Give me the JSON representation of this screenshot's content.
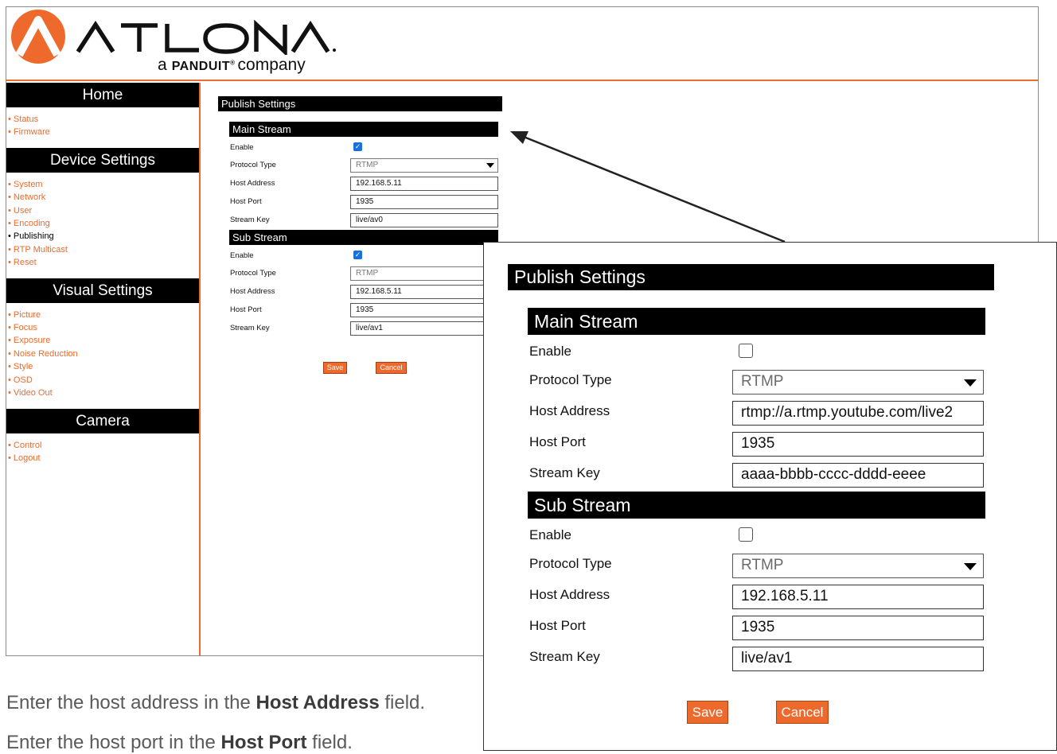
{
  "brand": {
    "wordmark": "ATLONA",
    "tagline_prefix": "a",
    "tagline_brand": "PANDUIT",
    "tagline_tm": "®",
    "tagline_suffix": "company",
    "accent_color": "#ee6a2c"
  },
  "sidebar": {
    "sections": [
      {
        "title": "Home",
        "items": [
          {
            "label": "Status"
          },
          {
            "label": "Firmware"
          }
        ]
      },
      {
        "title": "Device Settings",
        "items": [
          {
            "label": "System"
          },
          {
            "label": "Network"
          },
          {
            "label": "User"
          },
          {
            "label": "Encoding"
          },
          {
            "label": "Publishing",
            "active": true
          },
          {
            "label": "RTP Multicast"
          },
          {
            "label": "Reset"
          }
        ]
      },
      {
        "title": "Visual Settings",
        "items": [
          {
            "label": "Picture"
          },
          {
            "label": "Focus"
          },
          {
            "label": "Exposure"
          },
          {
            "label": "Noise Reduction"
          },
          {
            "label": "Style"
          },
          {
            "label": "OSD"
          },
          {
            "label": "Video Out"
          }
        ]
      },
      {
        "title": "Camera",
        "items": [
          {
            "label": "Control"
          },
          {
            "label": "Logout"
          }
        ]
      }
    ]
  },
  "publish_small": {
    "title": "Publish Settings",
    "main_stream": {
      "heading": "Main Stream",
      "enable_label": "Enable",
      "enabled": true,
      "protocol_label": "Protocol Type",
      "protocol": "RTMP",
      "host_address_label": "Host Address",
      "host_address": "192.168.5.11",
      "host_port_label": "Host Port",
      "host_port": "1935",
      "stream_key_label": "Stream Key",
      "stream_key": "live/av0"
    },
    "sub_stream": {
      "heading": "Sub Stream",
      "enable_label": "Enable",
      "enabled": true,
      "protocol_label": "Protocol Type",
      "protocol": "RTMP",
      "host_address_label": "Host Address",
      "host_address": "192.168.5.11",
      "host_port_label": "Host Port",
      "host_port": "1935",
      "stream_key_label": "Stream Key",
      "stream_key": "live/av1"
    },
    "save_label": "Save",
    "cancel_label": "Cancel"
  },
  "publish_zoom": {
    "title": "Publish Settings",
    "main_stream": {
      "heading": "Main Stream",
      "enable_label": "Enable",
      "enabled": false,
      "protocol_label": "Protocol Type",
      "protocol": "RTMP",
      "host_address_label": "Host Address",
      "host_address": "rtmp://a.rtmp.youtube.com/live2",
      "host_port_label": "Host Port",
      "host_port": "1935",
      "stream_key_label": "Stream Key",
      "stream_key": "aaaa-bbbb-cccc-dddd-eeee"
    },
    "sub_stream": {
      "heading": "Sub Stream",
      "enable_label": "Enable",
      "enabled": false,
      "protocol_label": "Protocol Type",
      "protocol": "RTMP",
      "host_address_label": "Host Address",
      "host_address": "192.168.5.11",
      "host_port_label": "Host Port",
      "host_port": "1935",
      "stream_key_label": "Stream Key",
      "stream_key": "live/av1"
    },
    "save_label": "Save",
    "cancel_label": "Cancel"
  },
  "instructions": {
    "line1_prefix": "Enter the host address in the ",
    "line1_bold": "Host Address",
    "line1_suffix": " field.",
    "line2_prefix": "Enter the host port in the ",
    "line2_bold": "Host Port",
    "line2_suffix": " field."
  }
}
